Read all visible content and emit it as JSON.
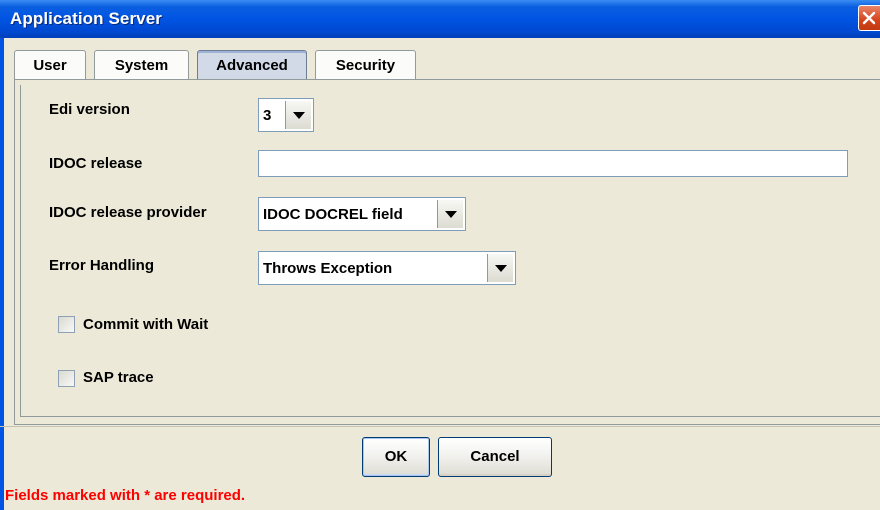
{
  "window": {
    "title": "Application Server"
  },
  "tabs": [
    {
      "label": "User"
    },
    {
      "label": "System"
    },
    {
      "label": "Advanced",
      "selected": true
    },
    {
      "label": "Security"
    }
  ],
  "form": {
    "edi_version": {
      "label": "Edi version",
      "value": "3"
    },
    "idoc_release": {
      "label": "IDOC release",
      "value": ""
    },
    "idoc_release_provider": {
      "label": "IDOC release provider",
      "value": "IDOC DOCREL field"
    },
    "error_handling": {
      "label": "Error Handling",
      "value": "Throws Exception"
    },
    "commit_with_wait": {
      "label": "Commit with Wait",
      "checked": false
    },
    "sap_trace": {
      "label": "SAP trace",
      "checked": false
    }
  },
  "buttons": {
    "ok": "OK",
    "cancel": "Cancel"
  },
  "footer": {
    "message": "Fields marked with * are required."
  },
  "colors": {
    "title_bar": "#0054e3",
    "required_message": "#ff0000"
  },
  "icons": {
    "close": "close-icon",
    "dropdown": "chevron-down-icon"
  }
}
